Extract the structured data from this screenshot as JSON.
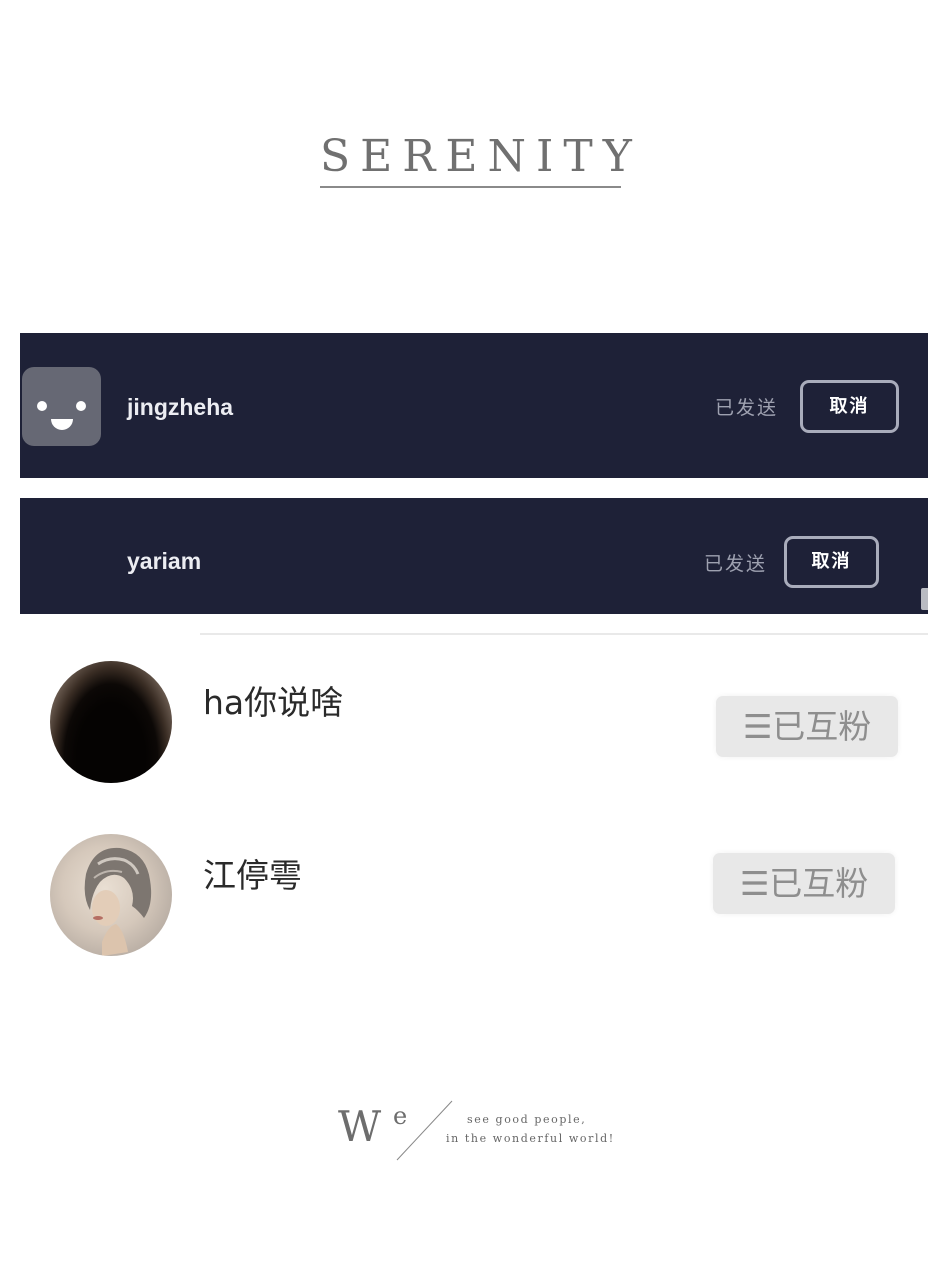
{
  "header": {
    "title": "SERENITY"
  },
  "sent_requests": [
    {
      "name": "jingzheha",
      "status": "已发送",
      "action": "取消",
      "avatar_icon": "robot-face-icon"
    },
    {
      "name": "yariam",
      "status": "已发送",
      "action": "取消"
    }
  ],
  "friends": [
    {
      "name": "ha你说啥",
      "relation_icon": "menu-lines-icon",
      "relation_label": "已互粉",
      "menu_glyph": "☰"
    },
    {
      "name": "江停雩",
      "relation_icon": "menu-lines-icon",
      "relation_label": "已互粉",
      "menu_glyph": "☰"
    }
  ],
  "footer_logo": {
    "letter_w": "W",
    "letter_e": "e",
    "tagline_1": "see good people,",
    "tagline_2": "in the wonderful world!"
  },
  "colors": {
    "dark_row_bg": "#1e2137",
    "mutual_button_bg": "#e8e8e8",
    "title_color": "#707070"
  }
}
